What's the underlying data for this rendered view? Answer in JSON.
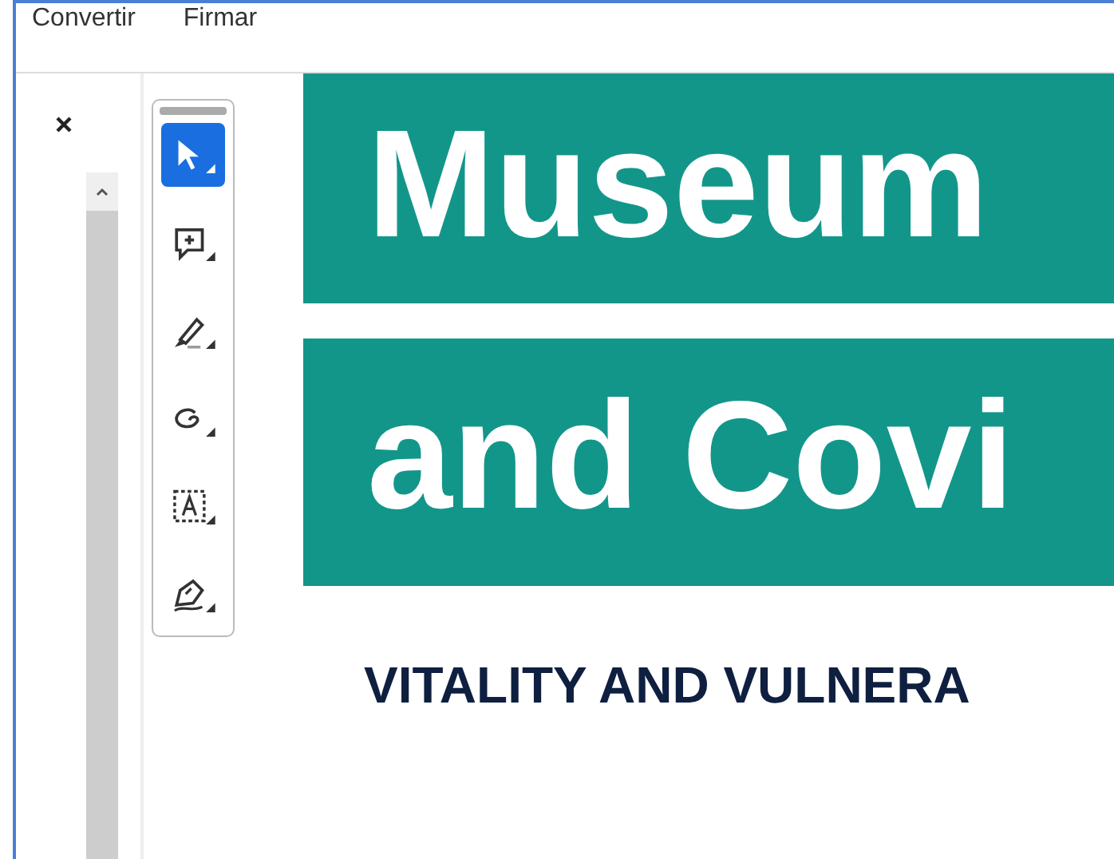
{
  "menu": [
    {
      "label": "Convertir"
    },
    {
      "label": "Firmar"
    }
  ],
  "tools": [
    {
      "kind": "select",
      "selected": true
    },
    {
      "kind": "comment",
      "selected": false
    },
    {
      "kind": "highlight",
      "selected": false
    },
    {
      "kind": "draw",
      "selected": false
    },
    {
      "kind": "text-select",
      "selected": false
    },
    {
      "kind": "sign",
      "selected": false
    }
  ],
  "document": {
    "title_lines": [
      "Museum",
      "and Covi"
    ],
    "subtitle": "VITALITY AND VULNERA"
  }
}
